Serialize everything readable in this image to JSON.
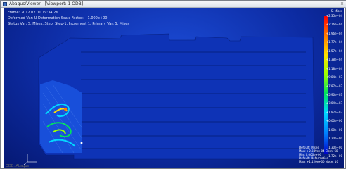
{
  "window": {
    "title": "Abaqus/Viewer - [Viewport: 1 ODB]",
    "minimize": "–",
    "close": "×"
  },
  "hud": {
    "step_line": "Frame: 2012.02.01 19:34:26",
    "deform_line": "Deformed Var: U  Deformation Scale Factor: +1.000e+00",
    "status_line": "Status Var: S, Mises; Step: Step-1; Increment 1; Primary Var: S, Mises"
  },
  "legend": {
    "title": "S, Mises",
    "values": [
      "+2.35e+04",
      "+2.16e+04",
      "+1.96e+04",
      "+1.77e+04",
      "+1.57e+04",
      "+1.38e+04",
      "+1.18e+04",
      "+9.84e+03",
      "+7.87e+03",
      "+5.90e+03",
      "+3.94e+03",
      "+1.97e+03",
      "+0.00e+00",
      "-1.00e+00",
      "-1.20e+00",
      "-1.30e+00",
      "-1.72e+00"
    ],
    "colors": [
      "#ff0000",
      "#ff7a00",
      "#ffe000",
      "#9dff00",
      "#00e060",
      "#00d8ff",
      "#0080ff",
      "#0000c8"
    ]
  },
  "status_block": {
    "lines": [
      "Default: Mises",
      "Max: +2.349e+04  Elem: 68",
      "Min: 0.000e+00",
      "Default: Deformation",
      "Max: +1.120e+00  Node: 10"
    ]
  },
  "bottom_label": "ODB: Abaqus",
  "icons": {
    "triad": "coordinate-triad-icon"
  }
}
